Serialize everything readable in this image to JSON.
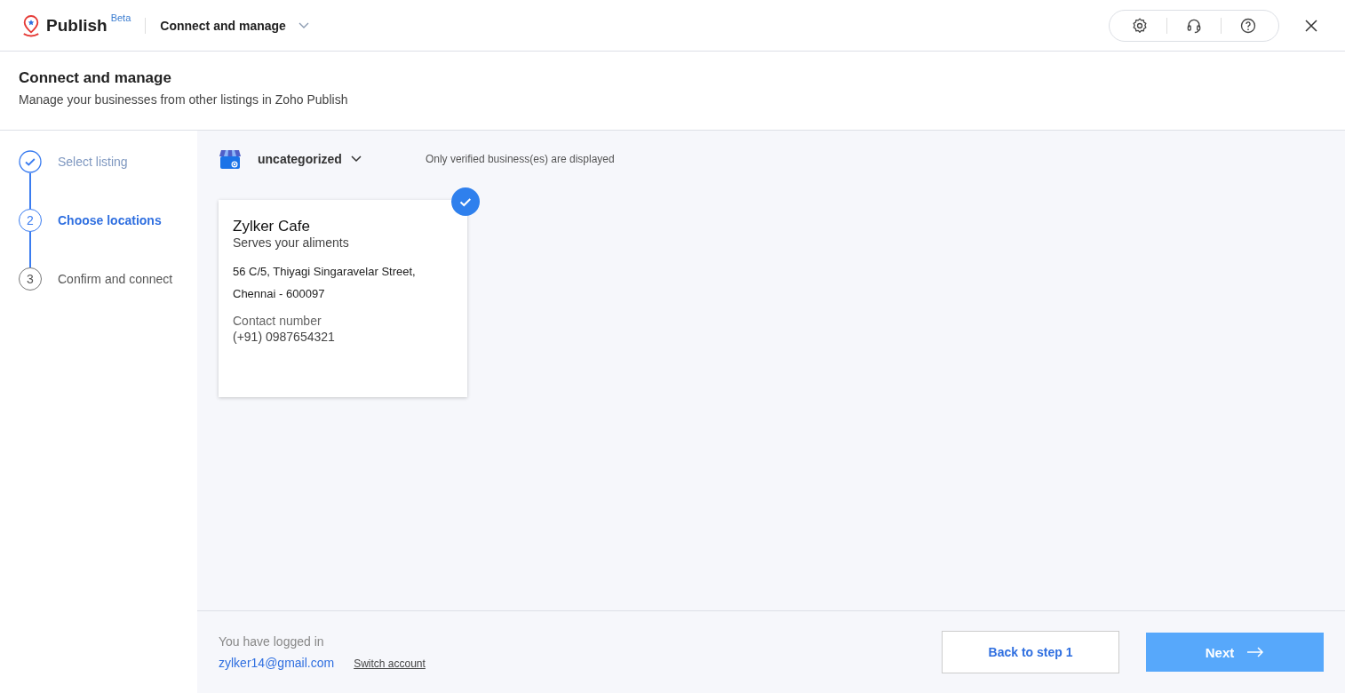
{
  "header": {
    "app_name": "Publish",
    "badge": "Beta",
    "section": "Connect and manage"
  },
  "page": {
    "title": "Connect and manage",
    "subtitle": "Manage your businesses from other listings in Zoho Publish"
  },
  "steps": [
    {
      "label": "Select listing",
      "completed": true,
      "selected": false
    },
    {
      "marker": "2",
      "label": "Choose locations",
      "completed": false,
      "selected": true
    },
    {
      "marker": "3",
      "label": "Confirm and connect",
      "completed": false,
      "selected": false
    }
  ],
  "filter": {
    "category": "uncategorized",
    "note": "Only verified business(es) are displayed"
  },
  "locations": [
    {
      "name": "Zylker Cafe",
      "tagline": "Serves your aliments",
      "address_line_1": "56 C/5, Thiyagi Singaravelar Street,",
      "address_line_2": "Chennai - 600097",
      "contact_label": "Contact number",
      "contact": "(+91) 0987654321",
      "selected": true
    }
  ],
  "footer": {
    "login_text": "You have logged in",
    "email": "zylker14@gmail.com",
    "switch_link": "Switch account",
    "back_button": "Back to step 1",
    "next_button": "Next"
  }
}
